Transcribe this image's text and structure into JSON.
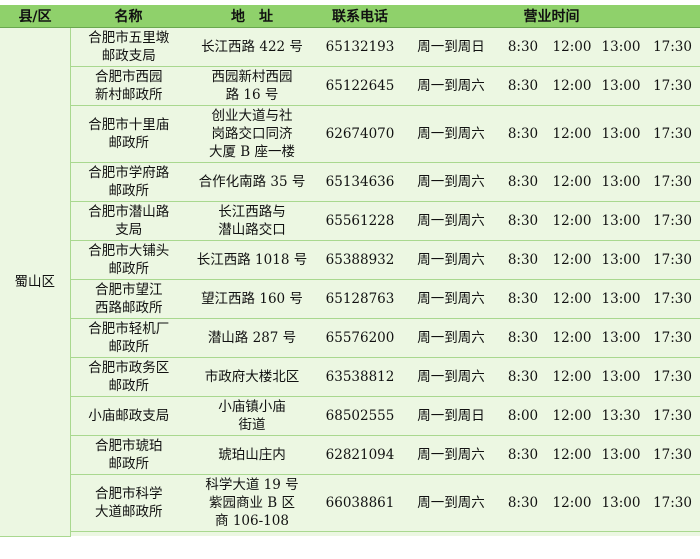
{
  "headers": {
    "county": "县/区",
    "name": "名称",
    "address": "地　址",
    "phone": "联系电话",
    "hours": "营业时间"
  },
  "county": "蜀山区",
  "rows": [
    {
      "name": "合肥市五里墩\n邮政支局",
      "address": "长江西路 422 号",
      "phone": "65132193",
      "days": "周一到周日",
      "t1": "8:30",
      "t2": "12:00",
      "t3": "13:00",
      "t4": "17:30"
    },
    {
      "name": "合肥市西园\n新村邮政所",
      "address": "西园新村西园\n路 16 号",
      "phone": "65122645",
      "days": "周一到周六",
      "t1": "8:30",
      "t2": "12:00",
      "t3": "13:00",
      "t4": "17:30"
    },
    {
      "name": "合肥市十里庙\n邮政所",
      "address": "创业大道与社\n岗路交口同济\n大厦 B 座一楼",
      "phone": "62674070",
      "days": "周一到周六",
      "t1": "8:30",
      "t2": "12:00",
      "t3": "13:00",
      "t4": "17:30"
    },
    {
      "name": "合肥市学府路\n邮政所",
      "address": "合作化南路 35 号",
      "phone": "65134636",
      "days": "周一到周六",
      "t1": "8:30",
      "t2": "12:00",
      "t3": "13:00",
      "t4": "17:30"
    },
    {
      "name": "合肥市潜山路\n支局",
      "address": "长江西路与\n潜山路交口",
      "phone": "65561228",
      "days": "周一到周六",
      "t1": "8:30",
      "t2": "12:00",
      "t3": "13:00",
      "t4": "17:30"
    },
    {
      "name": "合肥市大铺头\n邮政所",
      "address": "长江西路 1018 号",
      "phone": "65388932",
      "days": "周一到周六",
      "t1": "8:30",
      "t2": "12:00",
      "t3": "13:00",
      "t4": "17:30"
    },
    {
      "name": "合肥市望江\n西路邮政所",
      "address": "望江西路 160 号",
      "phone": "65128763",
      "days": "周一到周六",
      "t1": "8:30",
      "t2": "12:00",
      "t3": "13:00",
      "t4": "17:30"
    },
    {
      "name": "合肥市轻机厂\n邮政所",
      "address": "潜山路 287 号",
      "phone": "65576200",
      "days": "周一到周六",
      "t1": "8:30",
      "t2": "12:00",
      "t3": "13:00",
      "t4": "17:30"
    },
    {
      "name": "合肥市政务区\n邮政所",
      "address": "市政府大楼北区",
      "phone": "63538812",
      "days": "周一到周六",
      "t1": "8:30",
      "t2": "12:00",
      "t3": "13:00",
      "t4": "17:30"
    },
    {
      "name": "小庙邮政支局",
      "address": "小庙镇小庙\n街道",
      "phone": "68502555",
      "days": "周一到周日",
      "t1": "8:00",
      "t2": "12:00",
      "t3": "13:30",
      "t4": "17:30"
    },
    {
      "name": "合肥市琥珀\n邮政所",
      "address": "琥珀山庄内",
      "phone": "62821094",
      "days": "周一到周六",
      "t1": "8:30",
      "t2": "12:00",
      "t3": "13:00",
      "t4": "17:30"
    },
    {
      "name": "合肥市科学\n大道邮政所",
      "address": "科学大道 19 号\n紫园商业 B 区\n商 106-108",
      "phone": "66038861",
      "days": "周一到周六",
      "t1": "8:30",
      "t2": "12:00",
      "t3": "13:00",
      "t4": "17:30"
    }
  ]
}
